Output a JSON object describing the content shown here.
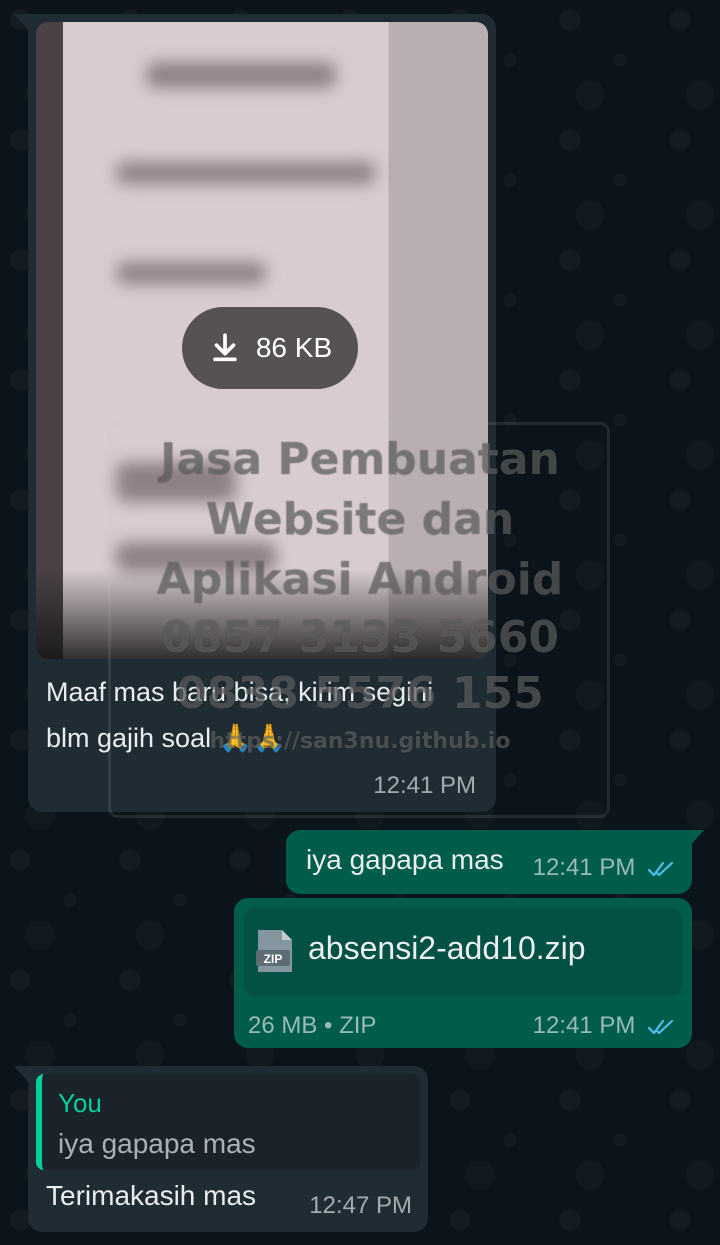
{
  "messages": {
    "image_message": {
      "download_size": "86 KB",
      "caption": "Maaf mas baru bisa, kirim segini blm gajih soal 🙏🙏",
      "time": "12:41 PM"
    },
    "outgoing_text": {
      "text": "iya gapapa mas",
      "time": "12:41 PM"
    },
    "file_message": {
      "file_icon_label": "ZIP",
      "file_name": "absensi2-add10.zip",
      "meta": "26 MB • ZIP",
      "time": "12:41 PM"
    },
    "reply_message": {
      "quote_author": "You",
      "quote_text": "iya gapapa mas",
      "text": "Terimakasih mas",
      "time": "12:47 PM"
    }
  },
  "watermark": {
    "line1": "Jasa Pembuatan",
    "line2": "Website dan",
    "line3": "Aplikasi Android",
    "line4": "0857 3133 5660",
    "line5": "0838 5576 155",
    "line6": "https://san3nu.github.io"
  },
  "colors": {
    "background": "#0b141a",
    "incoming_bubble": "#202c33",
    "outgoing_bubble": "#005c4b",
    "read_ticks": "#53bdeb",
    "quote_accent": "#06cf9c"
  },
  "icons": {
    "download": "download-arrow-icon",
    "read_receipt": "double-check-icon",
    "file": "zip-file-icon"
  }
}
